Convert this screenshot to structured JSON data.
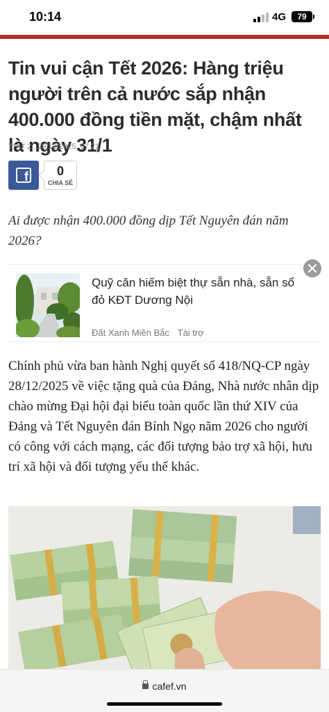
{
  "status": {
    "time": "10:14",
    "network": "4G",
    "battery": "79"
  },
  "article": {
    "title": "Tin vui cận Tết 2026: Hàng triệu người trên cả nước sắp nhận 400.000 đồng tiền mặt, chậm nhất là ngày 31/1",
    "meta": "THỨ 2 , 29/12/2025, 07:21",
    "share": {
      "count": "0",
      "label": "CHIA SẺ",
      "icon": "facebook-icon",
      "color": "#3b5998"
    },
    "sapo": "Ai được nhận 400.000 đồng dịp Tết Nguyên đán năm 2026?",
    "body": "Chính phủ vừa ban hành Nghị quyết số 418/NQ-CP ngày 28/12/2025 về việc tặng quà của Đảng, Nhà nước nhân dịp chào mừng Đại hội đại biểu toàn quốc lần thứ XIV của Đảng và Tết Nguyên đán Bính Ngọ năm 2026 cho người có công với cách mạng, các đối tượng bảo trợ xã hội, hưu trí xã hội và đối tượng yếu thế khác."
  },
  "ad": {
    "headline": "Quỹ căn hiếm biệt thự sẵn nhà, sẵn sổ đỏ KĐT Dương Nội",
    "source": "Đất Xanh Miền Bắc",
    "sponsored": "Tài trợ"
  },
  "browser": {
    "url": "cafef.vn"
  },
  "colors": {
    "accent": "#b3322a",
    "facebook": "#3b5998"
  }
}
